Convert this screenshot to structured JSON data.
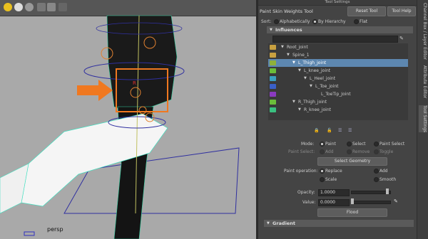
{
  "viewport": {
    "camera_label": "persp",
    "joint_label": "R"
  },
  "panel": {
    "window_title": "Tool Settings",
    "tool_name": "Paint Skin Weights Tool",
    "reset_button": "Reset Tool",
    "help_button": "Tool Help",
    "sort_label": "Sort:",
    "sort_options": [
      "Alphabetically",
      "By Hierarchy",
      "Flat"
    ],
    "influences_header": "Influences",
    "joints": [
      {
        "label": "Root_joint",
        "color": "#c8a040"
      },
      {
        "label": "Spine_1",
        "color": "#c8a040"
      },
      {
        "label": "L_Thigh_joint",
        "color": "#8fb13a"
      },
      {
        "label": "L_knee_joint",
        "color": "#6bbd3a"
      },
      {
        "label": "L_Heel_joint",
        "color": "#3aa0c0"
      },
      {
        "label": "L_Toe_joint",
        "color": "#3a60c8"
      },
      {
        "label": "L_ToeTip_Joint",
        "color": "#8a3ac0"
      },
      {
        "label": "R_Thigh_joint",
        "color": "#6bbd3a"
      },
      {
        "label": "R_knee_joint",
        "color": "#3ac080"
      }
    ],
    "mode_label": "Mode:",
    "mode_options": [
      "Paint",
      "Select",
      "Paint Select"
    ],
    "paint_select_label": "Paint Select:",
    "paint_select_options": [
      "Add",
      "Remove",
      "Toggle"
    ],
    "select_geometry_button": "Select Geometry",
    "paint_operation_label": "Paint operation:",
    "paint_operations": [
      "Replace",
      "Add",
      "Scale",
      "Smooth"
    ],
    "opacity_label": "Opacity:",
    "opacity_value": "1.0000",
    "value_label": "Value:",
    "value_value": "0.0000",
    "flood_button": "Flood",
    "gradient_header": "Gradient"
  },
  "vertical_tabs": [
    "Channel Box / Layer Editor",
    "Attribute Editor",
    "Tool Settings"
  ]
}
